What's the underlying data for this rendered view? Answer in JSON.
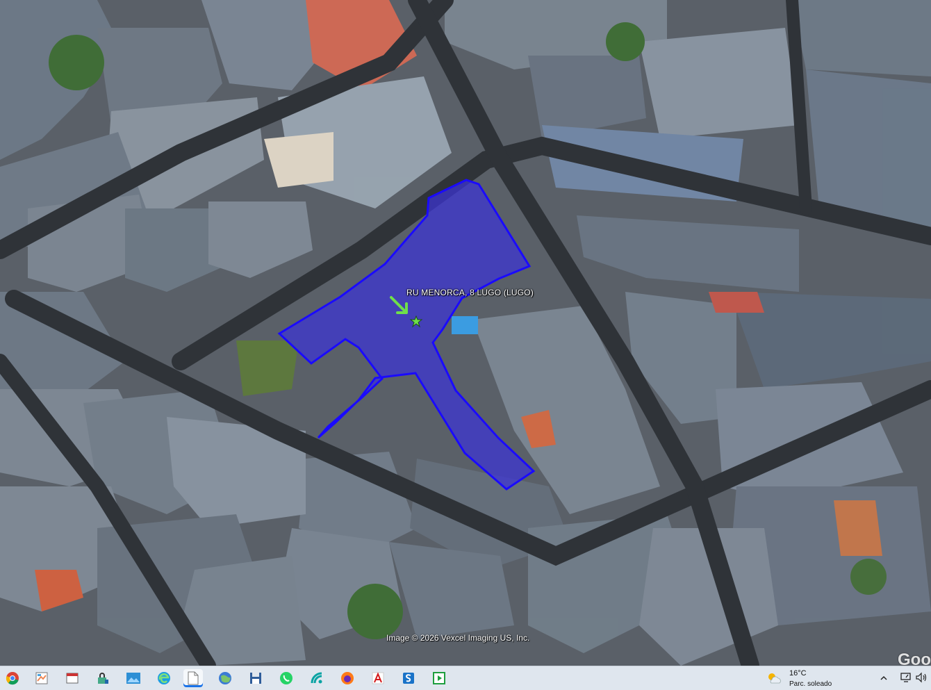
{
  "map": {
    "place_label": "RU MENORCA, 8  LUGO (LUGO)",
    "credit": "Image © 2026 Vexcel Imaging US, Inc.",
    "wordmark": "Goo",
    "colors": {
      "parcel_fill": "#3b33d6",
      "parcel_stroke": "#1a0aff",
      "pin": "#6fe04a"
    }
  },
  "taskbar": {
    "apps": [
      {
        "name": "chrome-icon",
        "active": false
      },
      {
        "name": "maps-app-icon",
        "active": false
      },
      {
        "name": "presentation-icon",
        "active": false
      },
      {
        "name": "security-lock-icon",
        "active": false
      },
      {
        "name": "photos-icon",
        "active": false
      },
      {
        "name": "edge-icon",
        "active": false
      },
      {
        "name": "document-icon",
        "active": true
      },
      {
        "name": "google-earth-icon",
        "active": false
      },
      {
        "name": "floppy-save-icon",
        "active": false
      },
      {
        "name": "whatsapp-icon",
        "active": false
      },
      {
        "name": "wireless-app-icon",
        "active": false
      },
      {
        "name": "firefox-icon",
        "active": false
      },
      {
        "name": "acrobat-icon",
        "active": false
      },
      {
        "name": "s-app-icon",
        "active": false
      },
      {
        "name": "media-player-icon",
        "active": false
      }
    ],
    "weather": {
      "temp": "16°C",
      "condition": "Parc. soleado"
    }
  }
}
